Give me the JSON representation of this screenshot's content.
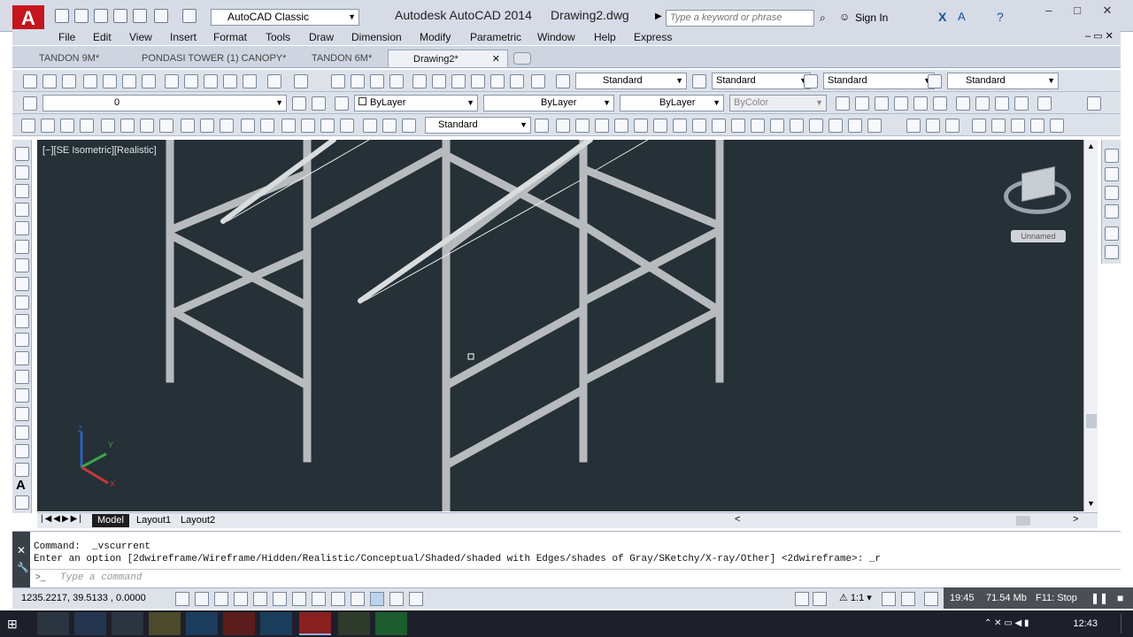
{
  "app": {
    "title": "Autodesk AutoCAD 2014",
    "drawing": "Drawing2.dwg",
    "workspace": "AutoCAD Classic"
  },
  "search": {
    "placeholder": "Type a keyword or phrase"
  },
  "signin": "Sign In",
  "menu": [
    "File",
    "Edit",
    "View",
    "Insert",
    "Format",
    "Tools",
    "Draw",
    "Dimension",
    "Modify",
    "Parametric",
    "Window",
    "Help",
    "Express"
  ],
  "file_tabs": [
    {
      "label": "TANDON 9M*"
    },
    {
      "label": "PONDASI TOWER (1) CANOPY*"
    },
    {
      "label": "TANDON 6M*"
    },
    {
      "label": "Drawing2*",
      "active": true
    }
  ],
  "styles": {
    "text": "Standard",
    "dim": "Standard",
    "table": "Standard",
    "mleader": "Standard"
  },
  "layer": {
    "current": "0"
  },
  "props": {
    "color": "ByLayer",
    "linetype": "ByLayer",
    "lineweight": "ByLayer",
    "plotstyle": "ByColor"
  },
  "dimstyle": "Standard",
  "viewport": {
    "label": "[−][SE Isometric][Realistic]",
    "named_view": "Unnamed"
  },
  "layout_tabs": [
    "Model",
    "Layout1",
    "Layout2"
  ],
  "command": {
    "line1": "Command:  _vscurrent",
    "line2": "Enter an option [2dwireframe/Wireframe/Hidden/Realistic/Conceptual/Shaded/shaded with Edges/shades of Gray/SKetchy/X-ray/Other] <2dwireframe>: _r",
    "placeholder": "Type a command"
  },
  "status": {
    "coords": "1235.2217, 39.5133 , 0.0000",
    "annoscale": "1:1",
    "time": "19:45",
    "memory": "71.54 Mb",
    "f11": "F11: Stop"
  },
  "taskbar": {
    "clock": "12:43"
  },
  "colors": {
    "viewport_bg": "#253037",
    "accent": "#c4161c"
  }
}
